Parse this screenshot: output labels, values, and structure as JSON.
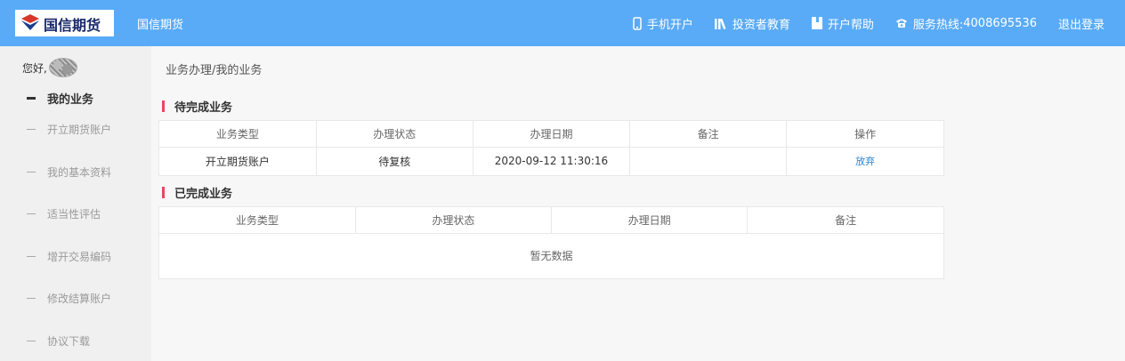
{
  "header": {
    "logo_text": "国信期货",
    "brand": "国信期货",
    "nav": {
      "mobile": "手机开户",
      "education": "投资者教育",
      "help": "开户帮助",
      "hotline_label": "服务热线:",
      "hotline_number": "4008695536",
      "logout": "退出登录"
    }
  },
  "sidebar": {
    "greeting": "您好,",
    "items": [
      {
        "label": "我的业务",
        "active": true
      },
      {
        "label": "开立期货账户"
      },
      {
        "label": "我的基本资料"
      },
      {
        "label": "适当性评估"
      },
      {
        "label": "增开交易编码"
      },
      {
        "label": "修改结算账户"
      },
      {
        "label": "协议下载"
      }
    ]
  },
  "main": {
    "breadcrumb": "业务办理/我的业务",
    "pending": {
      "title": "待完成业务",
      "columns": [
        "业务类型",
        "办理状态",
        "办理日期",
        "备注",
        "操作"
      ],
      "rows": [
        {
          "type": "开立期货账户",
          "status": "待复核",
          "date": "2020-09-12 11:30:16",
          "remark": "",
          "action": "放弃"
        }
      ]
    },
    "completed": {
      "title": "已完成业务",
      "columns": [
        "业务类型",
        "办理状态",
        "办理日期",
        "备注"
      ],
      "empty_text": "暂无数据"
    }
  },
  "colors": {
    "header_bg": "#5aabf7",
    "accent_bar": "#e8475f",
    "link": "#2b87d8"
  }
}
